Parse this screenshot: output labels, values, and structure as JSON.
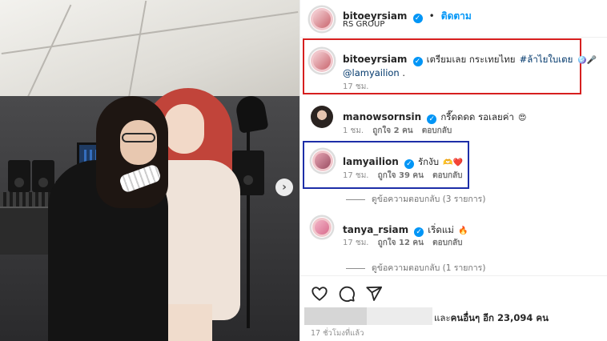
{
  "header": {
    "username": "bitoeyrsiam",
    "dot": "•",
    "follow_label": "ติดตาม",
    "subtitle": "RS GROUP"
  },
  "photo": {
    "next_arrow": "›"
  },
  "caption": {
    "username": "bitoeyrsiam",
    "text": "เตรียมเลย กระเทยไทย",
    "hashtag": "#ล้าไยใบเตย",
    "emoji": "🪩🎤",
    "mention": "@lamyailion",
    "mention_suffix": " .",
    "time": "17 ชม."
  },
  "comments": [
    {
      "username": "manowsornsin",
      "text": "กรี๊ดดดด รอเลยค่า",
      "emoji": "😍",
      "time": "1 ชม.",
      "likes": "ถูกใจ 2 คน",
      "reply": "ตอบกลับ"
    },
    {
      "username": "lamyailion",
      "text": "รักงับ",
      "emoji": "🫶❤️",
      "time": "17 ชม.",
      "likes": "ถูกใจ 39 คน",
      "reply": "ตอบกลับ",
      "view_replies": "ดูข้อความตอบกลับ (3 รายการ)"
    },
    {
      "username": "tanya_rsiam",
      "text": "เริ่ดแม่",
      "emoji": "🔥",
      "time": "17 ชม.",
      "likes": "ถูกใจ 12 คน",
      "reply": "ตอบกลับ",
      "view_replies": "ดูข้อความตอบกลับ (1 รายการ)"
    }
  ],
  "footer": {
    "likes_prefix": "และ",
    "likes_bold": "คนอื่นๆ อีก 23,094 คน",
    "time_ago": "17 ชั่วโมงที่แล้ว"
  },
  "icons": {
    "verified": "✓",
    "like": "heart-icon",
    "comment": "comment-icon",
    "share": "share-icon"
  },
  "colors": {
    "accent_blue": "#0095f6",
    "verified": "#0095f6",
    "highlight_red": "#d61f1f",
    "highlight_blue": "#1d2ea8"
  }
}
